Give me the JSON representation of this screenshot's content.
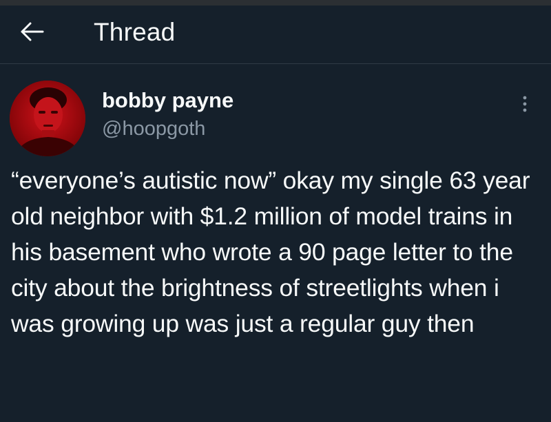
{
  "header": {
    "title": "Thread",
    "back_icon": "arrow-left-icon"
  },
  "tweet": {
    "author_name": "bobby payne",
    "author_handle": "@hoopgoth",
    "more_icon": "more-vertical-icon",
    "text": "“everyone’s autistic now” okay my single 63 year old neighbor with $1.2 million of model trains in his basement who wrote a 90 page letter to the city about the brightness of streetlights when i was growing up was just a regular guy then"
  },
  "colors": {
    "background": "#15202b",
    "text_primary": "#f7f9f9",
    "text_secondary": "#8b98a5",
    "avatar_red": "#a8060a"
  }
}
